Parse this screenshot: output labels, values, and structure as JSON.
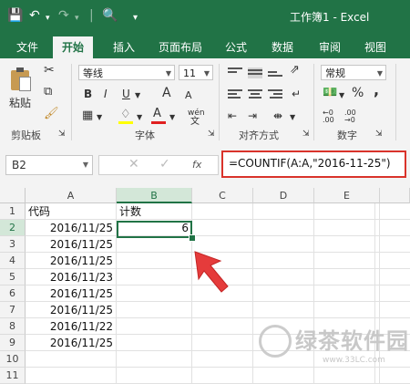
{
  "title": "工作簿1 - Excel",
  "tabs": [
    "文件",
    "开始",
    "插入",
    "页面布局",
    "公式",
    "数据",
    "审阅",
    "视图"
  ],
  "ribbon": {
    "paste_label": "粘贴",
    "clipboard_label": "剪贴板",
    "font_label": "字体",
    "align_label": "对齐方式",
    "number_label": "数字",
    "font_name": "等线",
    "font_size": "11",
    "number_format": "常规",
    "bold": "B",
    "italic": "I",
    "underline": "U",
    "grow_font": "A",
    "shrink_font": "A",
    "font_color": "A",
    "wen": "wén",
    "percent": "%",
    "comma": ","
  },
  "formula_bar": {
    "name_box": "B2",
    "fx": "fx",
    "formula": "=COUNTIF(A:A,\"2016-11-25\")"
  },
  "columns": [
    "A",
    "B",
    "C",
    "D",
    "E"
  ],
  "rows": [
    "1",
    "2",
    "3",
    "4",
    "5",
    "6",
    "7",
    "8",
    "9",
    "10",
    "11"
  ],
  "cells": {
    "A": [
      "代码",
      "2016/11/25",
      "2016/11/25",
      "2016/11/25",
      "2016/11/23",
      "2016/11/25",
      "2016/11/25",
      "2016/11/22",
      "2016/11/25"
    ],
    "B1": "计数",
    "B2": "6"
  },
  "watermark": {
    "name": "绿茶软件园",
    "url": "www.33LC.com"
  },
  "colors": {
    "excel_green": "#217346",
    "highlight_red": "#d9332b",
    "arrow_red": "#e53b3b"
  }
}
